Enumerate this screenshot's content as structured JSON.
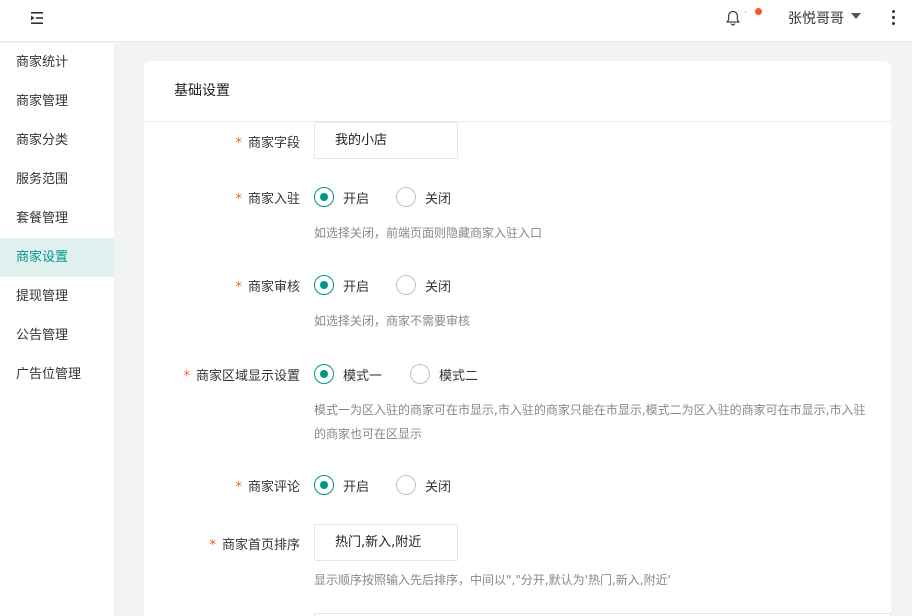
{
  "header": {
    "user_name": "张悦哥哥"
  },
  "sidebar": {
    "items": [
      {
        "label": "商家统计"
      },
      {
        "label": "商家管理"
      },
      {
        "label": "商家分类"
      },
      {
        "label": "服务范围"
      },
      {
        "label": "套餐管理"
      },
      {
        "label": "商家设置",
        "active": true
      },
      {
        "label": "提现管理"
      },
      {
        "label": "公告管理"
      },
      {
        "label": "广告位管理"
      }
    ]
  },
  "colors": {
    "accent": "#009688",
    "required": "#ff5722",
    "notification_dot": "#ff5722"
  },
  "form": {
    "title": "基础设置",
    "required_mark": "*",
    "merchant_field": {
      "label": "商家字段",
      "value": "我的小店"
    },
    "merchant_join": {
      "label": "商家入驻",
      "option_on": "开启",
      "option_off": "关闭",
      "selected": "开启",
      "hint": "如选择关闭，前端页面则隐藏商家入驻入口"
    },
    "merchant_review": {
      "label": "商家审核",
      "option_on": "开启",
      "option_off": "关闭",
      "selected": "开启",
      "hint": "如选择关闭，商家不需要审核"
    },
    "region_display": {
      "label": "商家区域显示设置",
      "option_1": "模式一",
      "option_2": "模式二",
      "selected": "模式一",
      "hint_line1": "模式一为区入驻的商家可在市显示,市入驻的商家只能在市显示,模式二为区入驻的商家可在市显示,市入驻",
      "hint_line2": "的商家也可在区显示"
    },
    "merchant_comment": {
      "label": "商家评论",
      "option_on": "开启",
      "option_off": "关闭",
      "selected": "开启"
    },
    "home_sort": {
      "label": "商家首页排序",
      "value": "热门,新入,附近",
      "hint": "显示顺序按照输入先后排序，中间以\",\"分开,默认为'热门,新入,附近'"
    }
  }
}
